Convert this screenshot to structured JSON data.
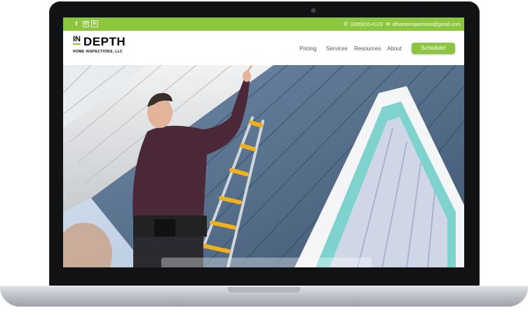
{
  "topbar": {
    "social": [
      "f",
      "ig",
      "in"
    ],
    "phone": "(206)910-4123",
    "email": "idhomeinspections@gmail.com"
  },
  "brand": {
    "in": "IN",
    "depth": "DEPTH",
    "sub": "HOME INSPECTIONS, LLC"
  },
  "nav": {
    "items": [
      "Pricing",
      "Services",
      "Resources",
      "About"
    ],
    "cta": "Schedule!"
  },
  "colors": {
    "accent": "#8cc63e",
    "bezel": "#111214"
  },
  "icons": {
    "phone": "phone-icon",
    "email": "mail-icon"
  }
}
